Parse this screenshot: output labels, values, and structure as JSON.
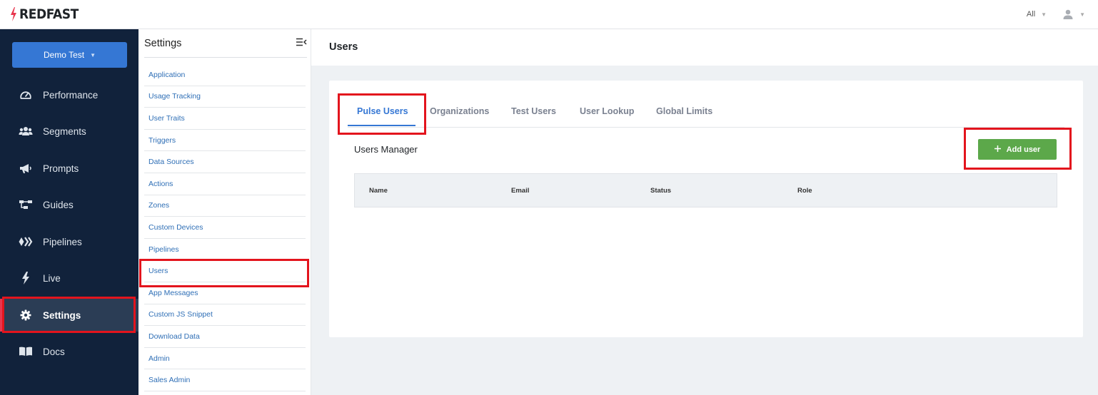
{
  "topbar": {
    "logo_text": "REDFAST",
    "env_filter": "All"
  },
  "sidebar": {
    "workspace": "Demo Test",
    "items": [
      {
        "label": "Performance",
        "icon": "speedometer-icon"
      },
      {
        "label": "Segments",
        "icon": "users-icon"
      },
      {
        "label": "Prompts",
        "icon": "megaphone-icon"
      },
      {
        "label": "Guides",
        "icon": "flowchart-icon"
      },
      {
        "label": "Pipelines",
        "icon": "pipeline-icon"
      },
      {
        "label": "Live",
        "icon": "bolt-icon"
      },
      {
        "label": "Settings",
        "icon": "gear-icon",
        "active": true
      },
      {
        "label": "Docs",
        "icon": "book-icon"
      }
    ]
  },
  "settings": {
    "title": "Settings",
    "items": [
      "Application",
      "Usage Tracking",
      "User Traits",
      "Triggers",
      "Data Sources",
      "Actions",
      "Zones",
      "Custom Devices",
      "Pipelines",
      "Users",
      "App Messages",
      "Custom JS Snippet",
      "Download Data",
      "Admin",
      "Sales Admin"
    ]
  },
  "main": {
    "title": "Users",
    "tabs": [
      "Pulse Users",
      "Organizations",
      "Test Users",
      "User Lookup",
      "Global Limits"
    ],
    "active_tab": "Pulse Users",
    "section_title": "Users Manager",
    "add_button": "Add user",
    "table_columns": [
      "Name",
      "Email",
      "Status",
      "Role"
    ]
  },
  "colors": {
    "sidebar_bg": "#11223b",
    "accent_blue": "#3577d4",
    "add_button_green": "#5ca84a",
    "highlight_red": "#e3141d",
    "brand_red": "#e8364e"
  }
}
